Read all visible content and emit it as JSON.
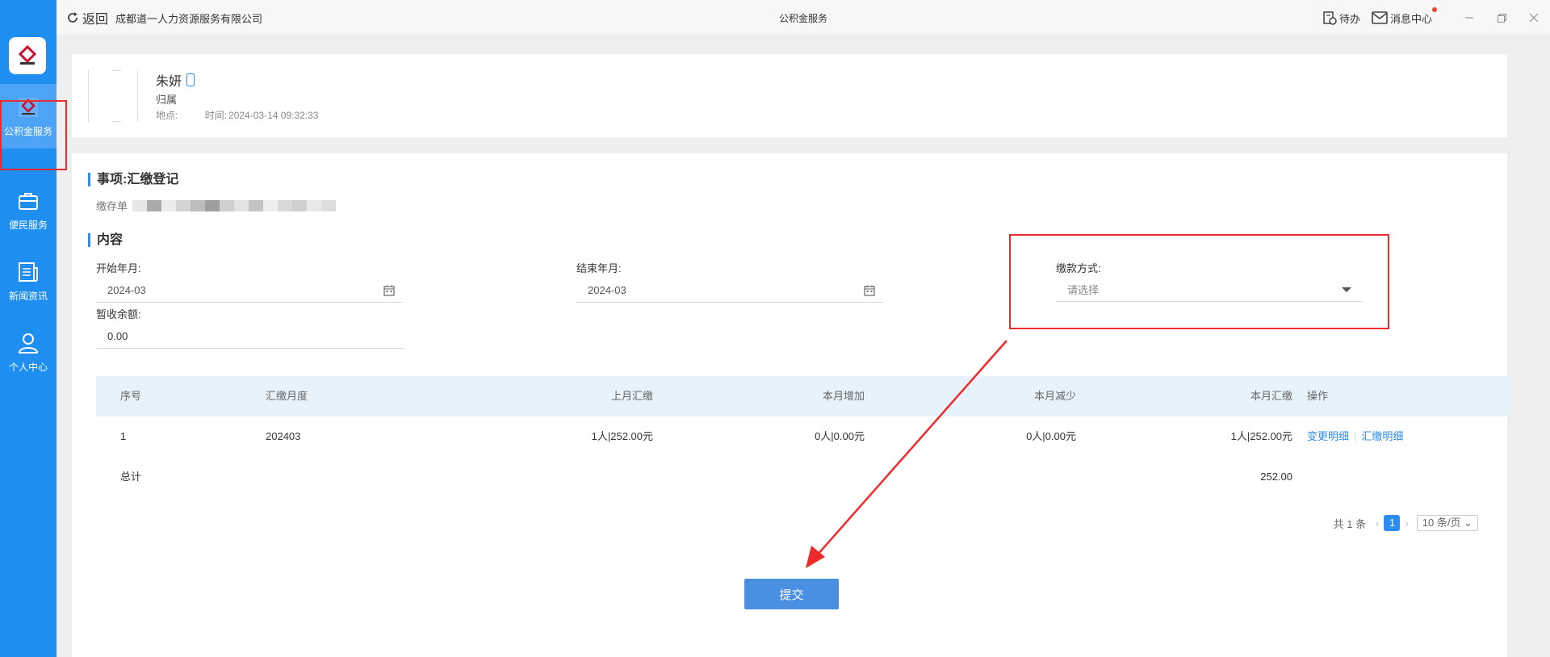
{
  "sidebar": {
    "items": [
      {
        "label": "公积金服务",
        "icon": "housing-fund-icon"
      },
      {
        "label": "便民服务",
        "icon": "briefcase-icon"
      },
      {
        "label": "新闻资讯",
        "icon": "news-icon"
      },
      {
        "label": "个人中心",
        "icon": "user-icon"
      }
    ],
    "active_color": "#4da3f5",
    "bg_color": "#1f8ef1"
  },
  "topbar": {
    "back_label": "返回",
    "company": "成都道一人力资源服务有限公司",
    "title": "公积金服务",
    "todo_label": "待办",
    "messages_label": "消息中心"
  },
  "profile": {
    "name": "朱妍",
    "belong_label": "归属",
    "location_label": "地点:",
    "time_label": "时间:",
    "time_value": "2024-03-14 09:32:33"
  },
  "matter": {
    "title": "事项:汇缴登记",
    "doc_label": "缴存单"
  },
  "content": {
    "title": "内容",
    "start_label": "开始年月:",
    "start_value": "2024-03",
    "end_label": "结束年月:",
    "end_value": "2024-03",
    "pay_method_label": "缴款方式:",
    "pay_method_placeholder": "请选择",
    "balance_label": "暂收余额:",
    "balance_value": "0.00"
  },
  "table": {
    "headers": [
      "序号",
      "汇缴月度",
      "上月汇缴",
      "本月增加",
      "本月减少",
      "本月汇缴",
      "操作"
    ],
    "rows": [
      {
        "no": "1",
        "month": "202403",
        "last": "1人|252.00元",
        "add": "0人|0.00元",
        "reduce": "0人|0.00元",
        "current": "1人|252.00元",
        "action1": "变更明细",
        "action2": "汇缴明细"
      }
    ],
    "total_label": "总计",
    "total_value": "252.00"
  },
  "pager": {
    "total": "共 1 条",
    "page": "1",
    "page_size": "10 条/页"
  },
  "submit_label": "提交",
  "accent_color": "#2d8cf0",
  "annotation_color": "#ee2b2b"
}
